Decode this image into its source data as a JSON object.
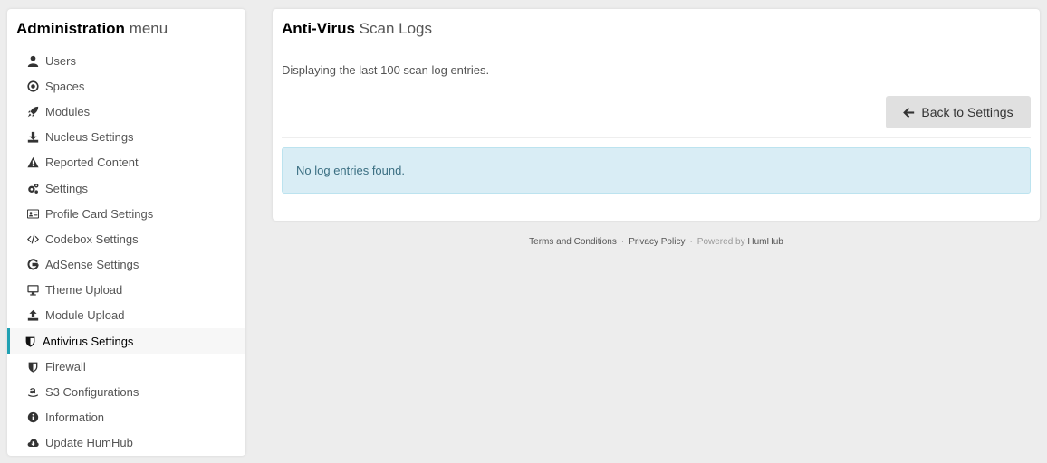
{
  "sidebar": {
    "title_bold": "Administration",
    "title_light": "menu",
    "items": [
      {
        "label": "Users",
        "icon": "user-icon"
      },
      {
        "label": "Spaces",
        "icon": "dot-circle-icon"
      },
      {
        "label": "Modules",
        "icon": "rocket-icon"
      },
      {
        "label": "Nucleus Settings",
        "icon": "download-icon"
      },
      {
        "label": "Reported Content",
        "icon": "warning-icon"
      },
      {
        "label": "Settings",
        "icon": "gears-icon"
      },
      {
        "label": "Profile Card Settings",
        "icon": "id-card-icon"
      },
      {
        "label": "Codebox Settings",
        "icon": "code-icon"
      },
      {
        "label": "AdSense Settings",
        "icon": "google-icon"
      },
      {
        "label": "Theme Upload",
        "icon": "desktop-icon"
      },
      {
        "label": "Module Upload",
        "icon": "upload-icon"
      },
      {
        "label": "Antivirus Settings",
        "icon": "shield-icon",
        "active": true
      },
      {
        "label": "Firewall",
        "icon": "shield-icon"
      },
      {
        "label": "S3 Configurations",
        "icon": "amazon-icon"
      },
      {
        "label": "Information",
        "icon": "info-circle-icon"
      },
      {
        "label": "Update HumHub",
        "icon": "cloud-download-icon"
      }
    ]
  },
  "panel": {
    "heading_bold": "Anti-Virus",
    "heading_light": "Scan Logs",
    "description": "Displaying the last 100 scan log entries.",
    "back_label": "Back to Settings",
    "alert_text": "No log entries found."
  },
  "footer": {
    "terms": "Terms and Conditions",
    "privacy": "Privacy Policy",
    "powered_prefix": "Powered by",
    "powered_brand": "HumHub"
  },
  "colors": {
    "accent": "#21a1b3",
    "alert_bg": "#d9edf5",
    "alert_text": "#3b6f82",
    "page_bg": "#ededed"
  }
}
